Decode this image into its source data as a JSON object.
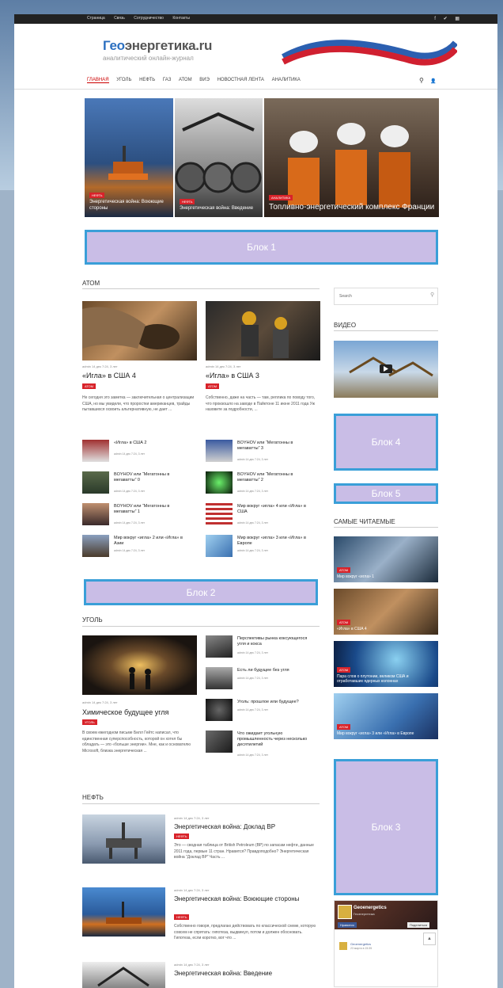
{
  "topbar": {
    "links": [
      "Страница",
      "Связь",
      "Сотрудничество",
      "Контакты"
    ],
    "social": [
      "f",
      "✔",
      "▦"
    ]
  },
  "logo": {
    "name_part1": "Гео",
    "name_part2": "энергетика.ru",
    "tagline": "аналитический онлайн-журнал"
  },
  "nav": {
    "items": [
      "Главная",
      "Уголь",
      "Нефть",
      "Газ",
      "Атом",
      "ВИЭ",
      "Новостная лента",
      "Аналитика"
    ],
    "search_icon": "⚲",
    "user_icon": "👤"
  },
  "hero": [
    {
      "tag": "НЕФТЬ",
      "caption": "Энергетическая война: Воюющие стороны"
    },
    {
      "tag": "НЕФТЬ",
      "caption": "Энергетическая война: Введение"
    },
    {
      "tag": "АНАЛИТИКА",
      "caption": "Топливно-энергетический комплекс Франции"
    }
  ],
  "blocks": {
    "b1": "Блок 1",
    "b2": "Блок 2",
    "b3": "Блок 3",
    "b4": "Блок 4",
    "b5": "Блок 5"
  },
  "atom": {
    "heading": "Атом",
    "main": [
      {
        "title": "«Игла» в США 4",
        "meta": "admin 14 дек 7:24, 3 лет",
        "tag": "АТОМ",
        "excerpt": "Не сегодня это заметка — заключительная о централизации США, но мы увидели, что проростки американцев, трайды пытавшихся освоить альтернативную, не дает ..."
      },
      {
        "title": "«Игла» в США 3",
        "meta": "admin 14 дек 7:24, 3 лет",
        "tag": "АТОМ",
        "excerpt": "Собственно, даже на часть — там, реплика по поводу того, что произошло на заводе в Пайктоне 11 июне 2011 года Уж назовите за подробности, ..."
      }
    ],
    "list_left": [
      {
        "title": "«Игла» в США 2",
        "meta": "admin 14 дек 7:24, 3 лет"
      },
      {
        "title": "BOYHOV или “Мегатонны в мегаватты” 0",
        "meta": "admin 14 дек 7:24, 3 лет"
      },
      {
        "title": "BOYHOV или “Мегатонны в мегаватты” 1",
        "meta": "admin 14 дек 7:24, 3 лет"
      },
      {
        "title": "Мир вокруг «игла» 2 или «Игла» в Азии",
        "meta": "admin 14 дек 7:24, 3 лет"
      }
    ],
    "list_right": [
      {
        "title": "BOYHOV или “Мегатонны в мегаватты” 3",
        "meta": "admin 14 дек 7:24, 3 лет"
      },
      {
        "title": "BOYHOV или “Мегатонны в мегаватты” 2",
        "meta": "admin 14 дек 7:24, 3 лет"
      },
      {
        "title": "Мир вокруг «игла» 4 или «Игла» в США",
        "meta": "admin 14 дек 7:24, 3 лет"
      },
      {
        "title": "Мир вокруг «игла» 3 или «Игла» в Европе",
        "meta": "admin 14 дек 7:24, 3 лет"
      }
    ]
  },
  "ugol": {
    "heading": "Уголь",
    "main": {
      "title": "Химическое будущее угля",
      "meta": "admin 14 дек 7:24, 3 лет",
      "tag": "УГОЛЬ",
      "excerpt": "В своем ежегодном письме Билл Гейтс написал, что единственная суперспособность, которой он хотел бы обладать — это «больше энергии». Мне, как и основателю Microsoft, близка энергетическая ..."
    },
    "list": [
      {
        "title": "Перспективы рынка коксующегося угля и кокса",
        "meta": "admin 14 дек 7:24, 3 лет"
      },
      {
        "title": "Есть ли будущее без угля",
        "meta": "admin 14 дек 7:24, 3 лет"
      },
      {
        "title": "Уголь: прошлое или будущее?",
        "meta": "admin 14 дек 7:24, 3 лет"
      },
      {
        "title": "Что ожидает угольную промышленность через несколько десятилетий",
        "meta": "admin 14 дек 7:24, 3 лет"
      }
    ]
  },
  "neft": {
    "heading": "Нефть",
    "items": [
      {
        "title": "Энергетическая война: Доклад BP",
        "meta": "admin 14 дек 7:24, 3 лет",
        "tag": "НЕФТЬ",
        "excerpt": "Это — сводная таблица от British Petroleum (BP) по запасам нефти, данные 2011 года, первые 11 стран. Нравится? Правдоподобно? Энергетическая война “Доклад BP” Часть ..."
      },
      {
        "title": "Энергетическая война: Воюющие стороны",
        "meta": "admin 14 дек 7:24, 3 лет",
        "tag": "НЕФТЬ",
        "excerpt": "Собственно говоря, предлагаю действовать по классической схеме, которую совсем не спрятать: гипотеза, выдвинул, потом и должен обосновать. Гипотеза, если коротко, вот что ..."
      },
      {
        "title": "Энергетическая война: Введение",
        "meta": "admin 14 дек 7:24, 3 лет",
        "tag": "НЕФТЬ",
        "excerpt": ""
      }
    ]
  },
  "sidebar": {
    "search_placeholder": "Search",
    "video_heading": "Видео",
    "popular_heading": "Самые читаемые",
    "popular": [
      {
        "tag": "АТОМ",
        "caption": "Мир вокруг «игла» 1"
      },
      {
        "tag": "АТОМ",
        "caption": "«Игла» в США 4"
      },
      {
        "tag": "АТОМ",
        "caption": "Пара слов о плутонии, великом США и отработавших ядерных колоннах"
      },
      {
        "tag": "АТОМ",
        "caption": "Мир вокруг «игла» 3 или «Игла» в Европе"
      }
    ],
    "fb": {
      "name": "Geoenergetics",
      "sub": "Геоэнергетика",
      "like": "Нравится",
      "share": "Поделиться",
      "post_author": "Geoenergetics",
      "post_time": "23 марта в 15:35"
    }
  },
  "colors": {
    "accent": "#d8232a",
    "brand_blue": "#2b6fc0",
    "block_fill": "#c9bde6",
    "block_border": "#3a9fd8"
  }
}
